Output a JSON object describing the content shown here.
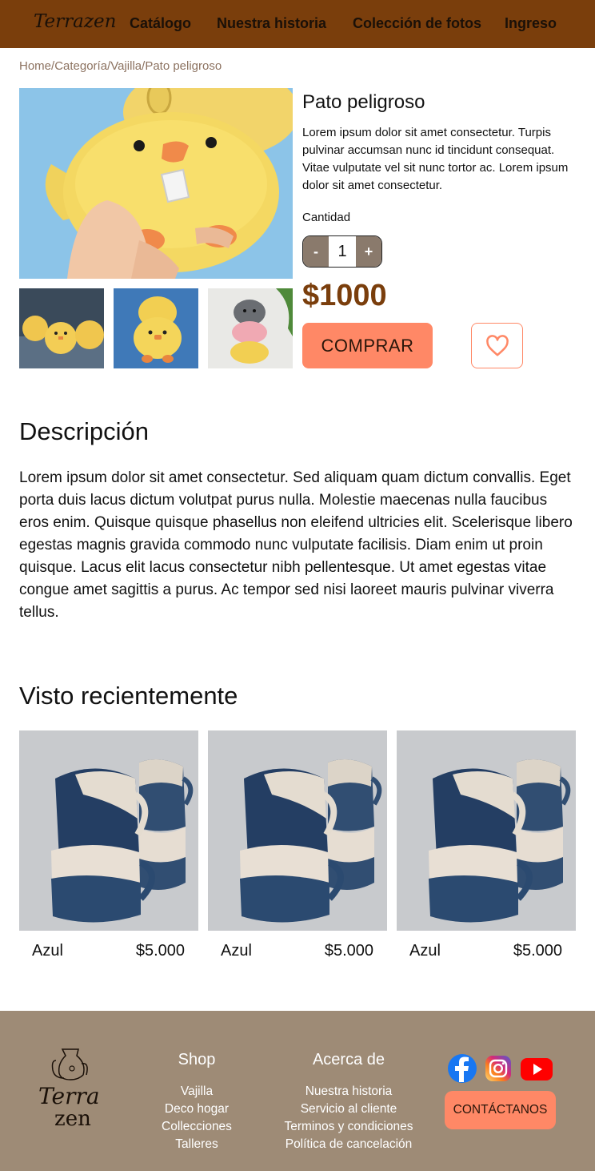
{
  "header": {
    "brand": "Terrazen",
    "nav": [
      "Catálogo",
      "Nuestra historia",
      "Colección de fotos",
      "Ingreso"
    ]
  },
  "breadcrumb": [
    "Home",
    "/",
    "Categoría",
    "/",
    "Vajilla",
    "/",
    "Pato peligroso"
  ],
  "product": {
    "title": "Pato peligroso",
    "short_description": "Lorem ipsum dolor sit amet consectetur. Turpis pulvinar accumsan nunc id tincidunt consequat. Vitae vulputate vel sit nunc tortor ac. Lorem ipsum dolor sit amet consectetur.",
    "quantity_label": "Cantidad",
    "quantity_minus": "-",
    "quantity_value": "1",
    "quantity_plus": "+",
    "price": "$1000",
    "buy_label": "COMPRAR",
    "favorite_icon": "heart-icon"
  },
  "description": {
    "heading": "Descripción",
    "text": "Lorem ipsum dolor sit amet consectetur. Sed aliquam quam dictum convallis. Eget porta duis lacus dictum volutpat purus nulla. Molestie maecenas nulla faucibus eros enim. Quisque quisque phasellus non eleifend ultricies elit. Scelerisque libero egestas magnis gravida commodo nunc vulputate facilisis. Diam enim ut proin quisque. Lacus elit lacus consectetur nibh pellentesque. Ut amet egestas vitae congue amet sagittis a purus. Ac tempor sed nisi laoreet mauris pulvinar viverra tellus."
  },
  "recent": {
    "heading": "Visto recientemente",
    "items": [
      {
        "name": "Azul",
        "price": "$5.000"
      },
      {
        "name": "Azul",
        "price": "$5.000"
      },
      {
        "name": "Azul",
        "price": "$5.000"
      }
    ]
  },
  "footer": {
    "logo_line1": "Terra",
    "logo_line2": "zen",
    "shop_heading": "Shop",
    "shop_links": [
      "Vajilla",
      "Deco hogar",
      "Collecciones",
      "Talleres"
    ],
    "about_heading": "Acerca de",
    "about_links": [
      "Nuestra historia",
      "Servicio al cliente",
      "Terminos y condiciones",
      "Política de cancelación"
    ],
    "social_icons": [
      "facebook-icon",
      "instagram-icon",
      "youtube-icon"
    ],
    "contact_label": "CONTÁCTANOS"
  },
  "colors": {
    "header_bg": "#7a3e0c",
    "accent": "#ff8866",
    "price": "#7a3e0c",
    "footer_bg": "#9e8b76",
    "breadcrumb": "#8c7260"
  }
}
